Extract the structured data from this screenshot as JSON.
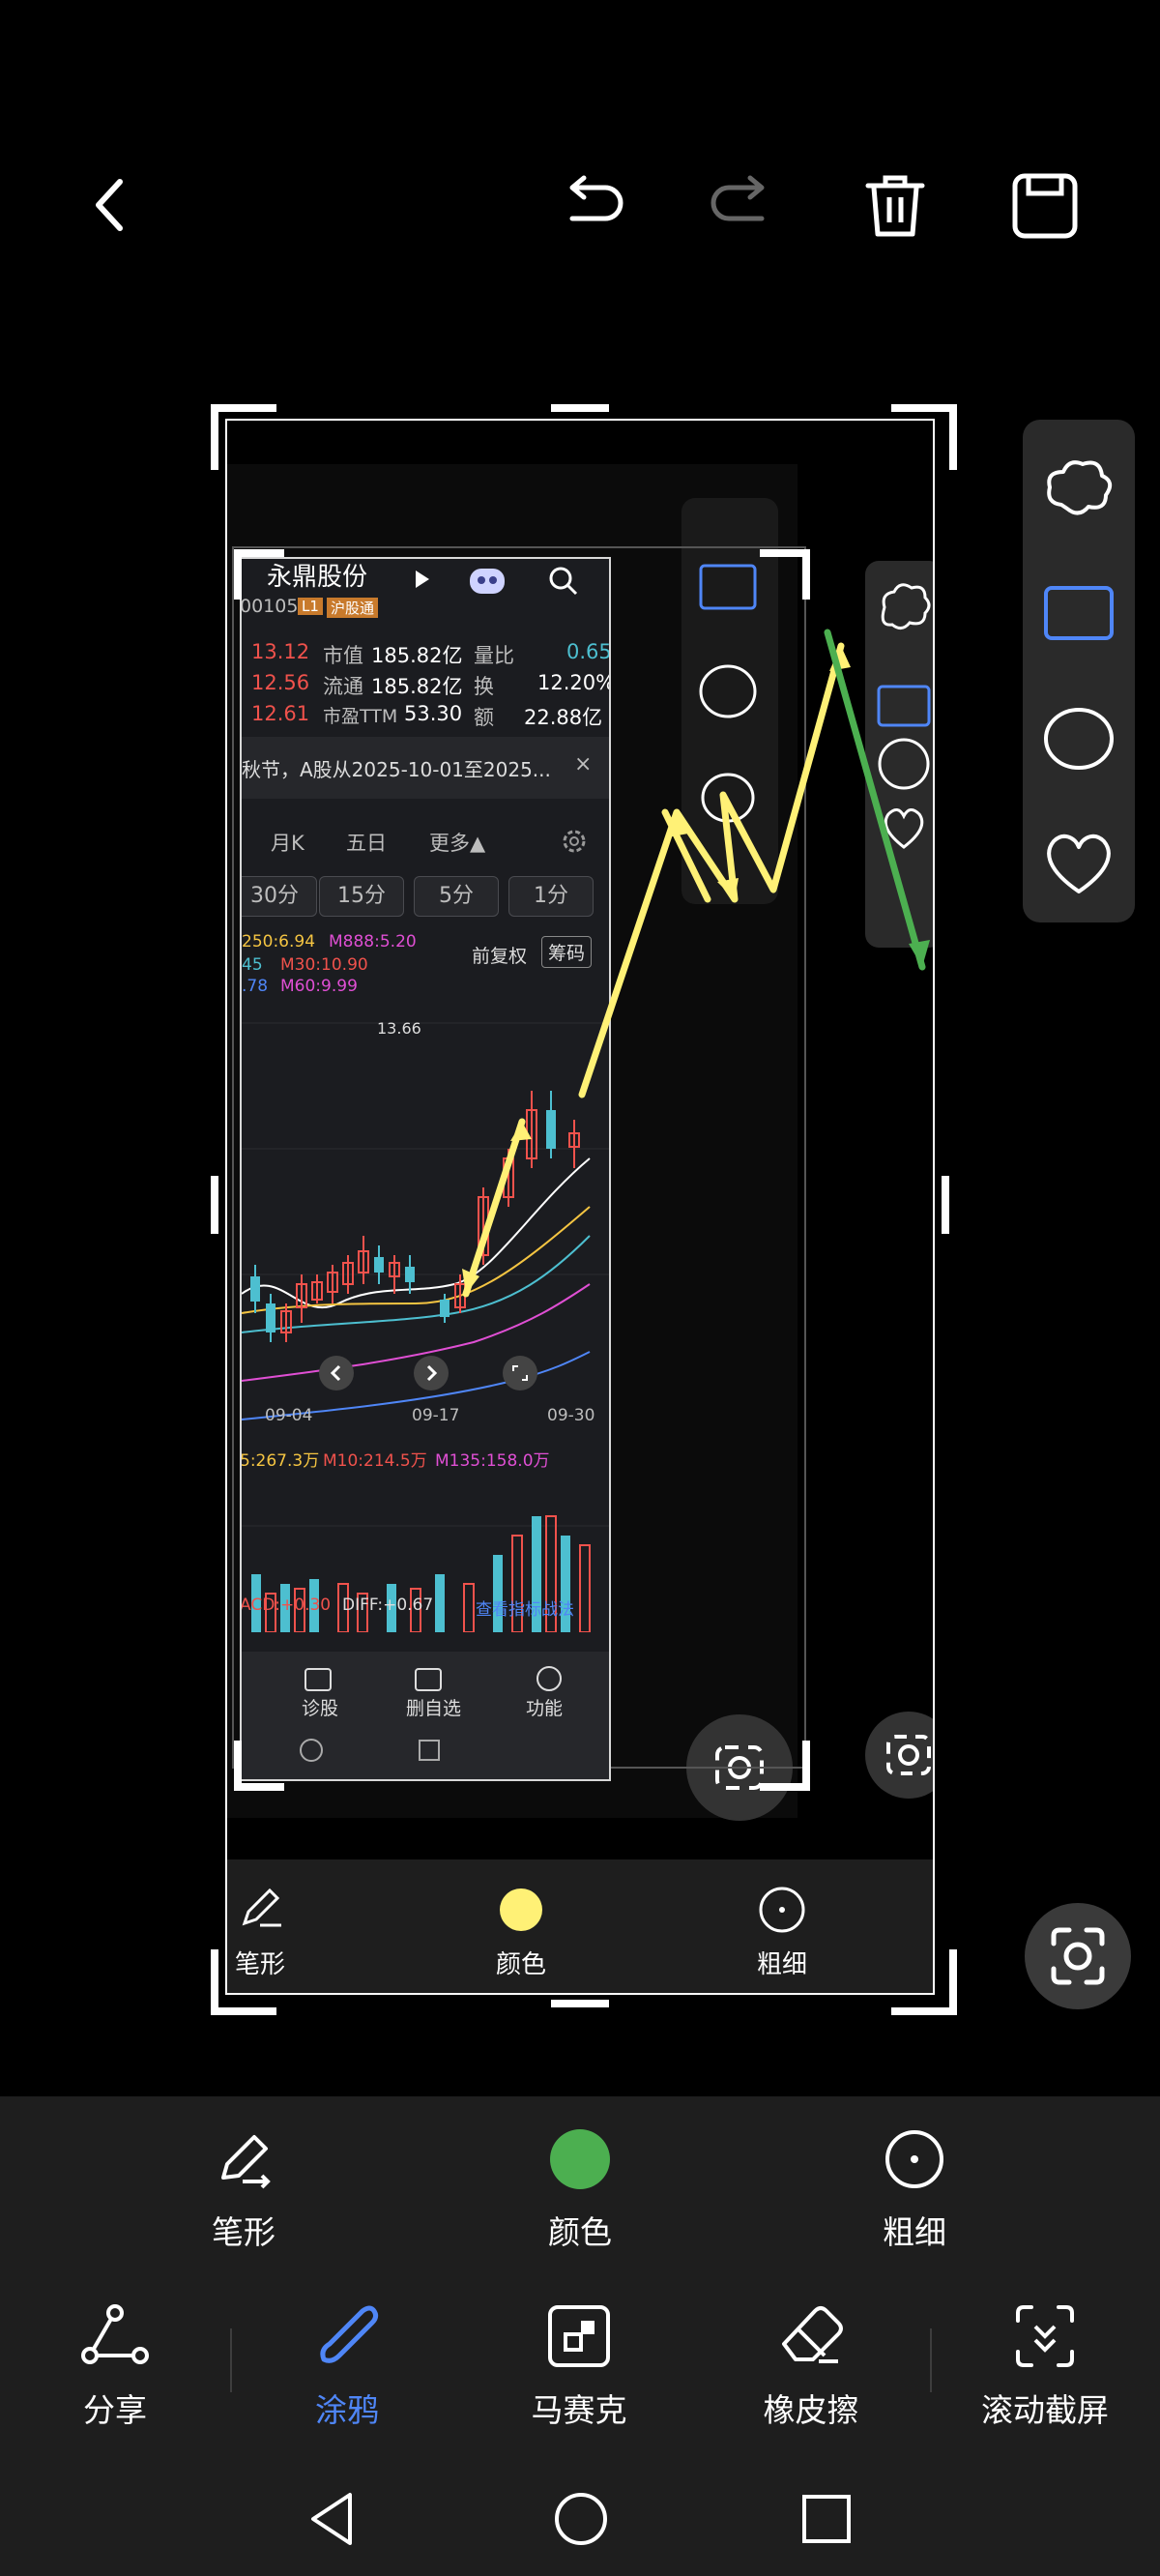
{
  "colors": {
    "accent": "#4f86f7",
    "selected_color": "#4caf50",
    "inner_selected_color": "#fff176",
    "background": "#000000",
    "panel": "#1e1e1e"
  },
  "top_bar": {
    "icons": [
      "back-icon",
      "undo-icon",
      "redo-icon",
      "delete-icon",
      "save-icon"
    ]
  },
  "screenshot": {
    "stock": {
      "name": "永鼎股份",
      "code": "00105",
      "tag_l1": "L1",
      "tag_market": "沪股通",
      "prices": [
        "13.12",
        "12.56",
        "12.61"
      ],
      "rows": [
        {
          "k1": "市值",
          "v1": "185.82亿",
          "k2": "量比",
          "v2": "0.65"
        },
        {
          "k1": "流通",
          "v1": "185.82亿",
          "k2": "换",
          "v2": "12.20%"
        },
        {
          "k1": "市盈TTM",
          "v1": "53.30",
          "k2": "额",
          "v2": "22.88亿"
        }
      ],
      "notice": "秋节，A股从2025-10-01至2025...",
      "notice_close": "×",
      "period_tabs": [
        "月K",
        "五日",
        "更多▲"
      ],
      "interval_pills": [
        "30分",
        "15分",
        "5分",
        "1分"
      ],
      "ma_line1": [
        "250:6.94",
        "M888:5.20"
      ],
      "ma_line2": [
        "45",
        "M30:10.90"
      ],
      "ma_line3": [
        ".78",
        "M60:9.99"
      ],
      "fq_label": "前复权",
      "chip_label": "筹码",
      "high_price": "13.66",
      "dates": [
        "09-04",
        "09-17",
        "09-30"
      ],
      "vol_line": [
        "5:267.3万",
        "M10:214.5万",
        "M135:158.0万"
      ],
      "macd_line": [
        "ACD:+0.30",
        "DIFF:+0.67"
      ],
      "indicator_link": "查看指标战法",
      "bottom_nav": [
        "诊股",
        "删自选",
        "功能"
      ]
    },
    "inner_options": [
      {
        "label": "笔形",
        "icon": "pen-style-icon"
      },
      {
        "label": "颜色",
        "icon": "color-dot-icon"
      },
      {
        "label": "粗细",
        "icon": "thickness-icon"
      }
    ]
  },
  "shape_panel": {
    "icons": [
      "cloud-shape-icon",
      "rectangle-shape-icon",
      "circle-shape-icon",
      "heart-shape-icon"
    ]
  },
  "options": [
    {
      "label": "笔形",
      "icon": "pen-style-icon"
    },
    {
      "label": "颜色",
      "icon": "color-dot-icon"
    },
    {
      "label": "粗细",
      "icon": "thickness-icon"
    }
  ],
  "tools": [
    {
      "label": "分享",
      "icon": "share-icon"
    },
    {
      "label": "涂鸦",
      "icon": "doodle-icon"
    },
    {
      "label": "马赛克",
      "icon": "mosaic-icon"
    },
    {
      "label": "橡皮擦",
      "icon": "eraser-icon"
    },
    {
      "label": "滚动截屏",
      "icon": "scroll-screenshot-icon"
    }
  ],
  "nav": [
    "back-nav-icon",
    "home-nav-icon",
    "recents-nav-icon"
  ]
}
